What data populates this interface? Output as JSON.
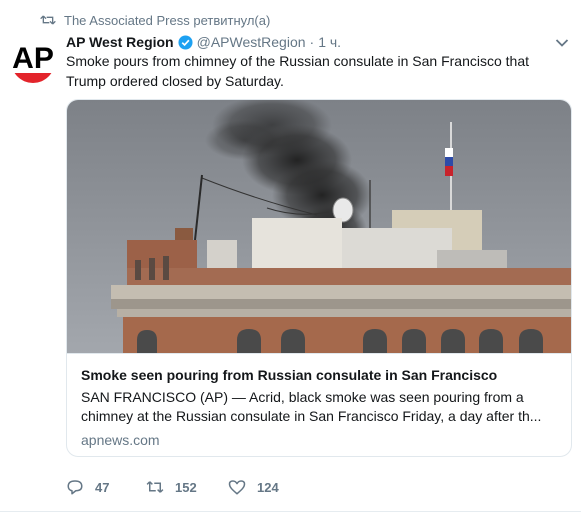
{
  "retweet_context": {
    "text": "The Associated Press ретвитнул(а)"
  },
  "author": {
    "name": "AP West Region",
    "handle": "@APWestRegion",
    "time": "1 ч.",
    "separator": "·",
    "avatar_text": "AP"
  },
  "tweet": {
    "text": "Smoke pours from chimney of the Russian consulate in San Francisco that Trump ordered closed by Saturday."
  },
  "card": {
    "title": "Smoke seen pouring from Russian consulate in San Francisco",
    "description": "SAN FRANCISCO (AP) — Acrid, black smoke was seen pouring from a chimney at the Russian consulate in San Francisco Friday, a day after th...",
    "domain": "apnews.com"
  },
  "actions": {
    "reply_count": "47",
    "retweet_count": "152",
    "like_count": "124"
  },
  "colors": {
    "secondary_text": "#657786",
    "verified_blue": "#1da1f2",
    "ap_red": "#e3242b"
  }
}
